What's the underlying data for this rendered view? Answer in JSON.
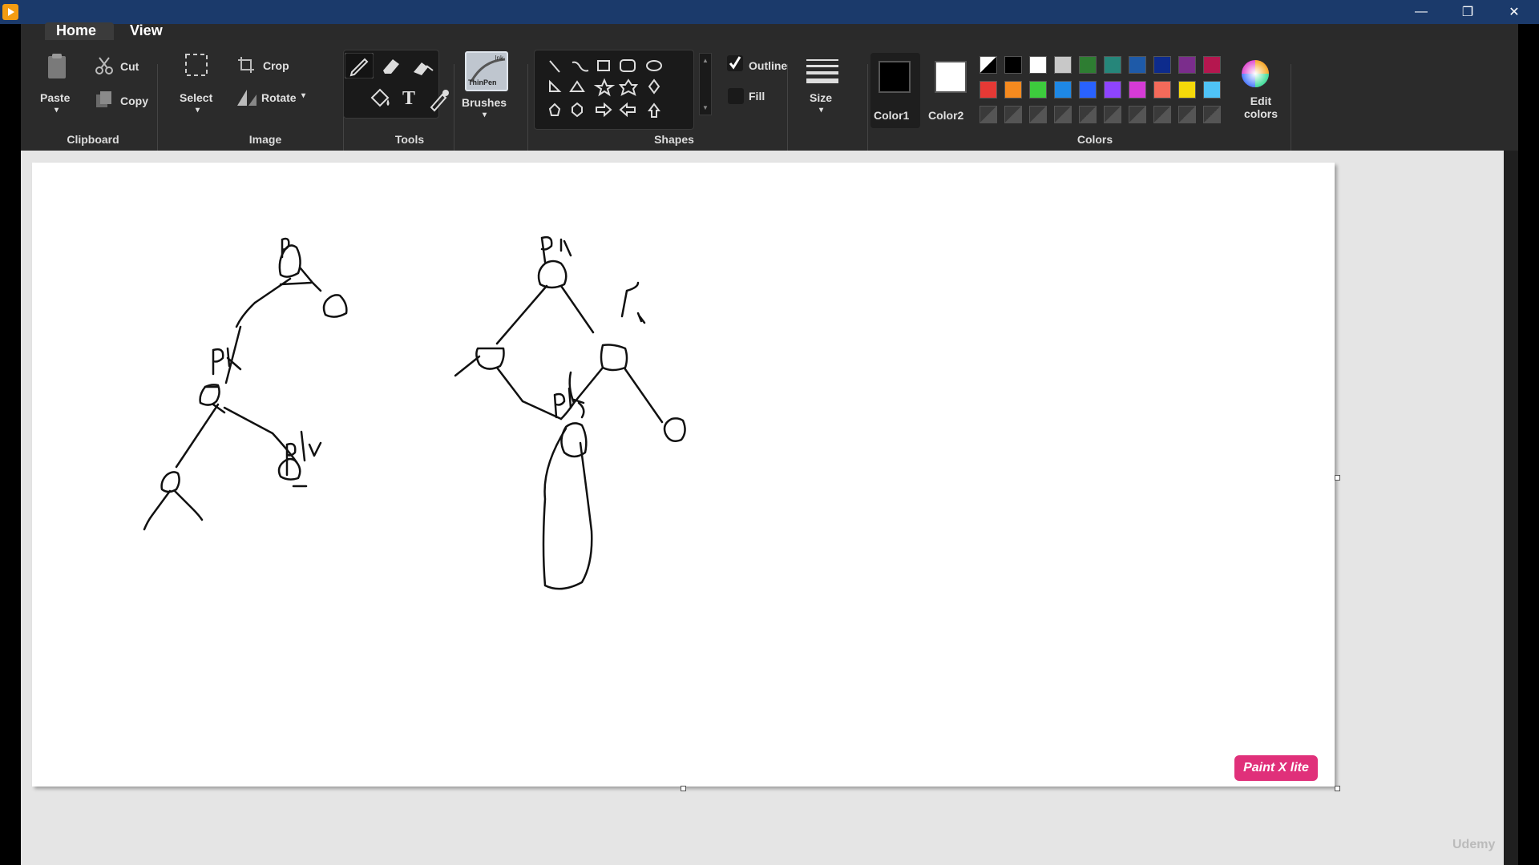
{
  "window": {
    "minimize": "—",
    "restore": "❐",
    "close": "✕"
  },
  "tabs": [
    {
      "label": "Home"
    },
    {
      "label": "View"
    }
  ],
  "clipboard": {
    "paste": "Paste",
    "cut": "Cut",
    "copy": "Copy",
    "group": "Clipboard"
  },
  "image": {
    "select": "Select",
    "crop": "Crop",
    "rotate": "Rotate",
    "group": "Image"
  },
  "tools": {
    "group": "Tools",
    "text_tool": "T"
  },
  "brushes": {
    "label": "Brushes",
    "preview_line1": "Ink",
    "preview_line2": "ThinPen"
  },
  "shapes": {
    "group": "Shapes",
    "outline": "Outline",
    "fill": "Fill",
    "outline_checked": true
  },
  "size": {
    "label": "Size"
  },
  "colors": {
    "group": "Colors",
    "color1_label": "Color1",
    "color2_label": "Color2",
    "color1": "#000000",
    "color2": "#ffffff",
    "edit_line1": "Edit",
    "edit_line2": "colors",
    "row1": [
      "diag",
      "#000000",
      "#ffffff",
      "#c8c8c8",
      "#2e7d32",
      "#26867a",
      "#1e5aa8",
      "#0d2b8c",
      "#7b2d8c",
      "#b5174f"
    ],
    "row2": [
      "#e53935",
      "#f58a1f",
      "#3dcb3d",
      "#1e88e5",
      "#2962ff",
      "#8e44ff",
      "#d63bd6",
      "#f46a5a",
      "#f5d90a",
      "#4fc3f7"
    ],
    "row3_count": 10
  },
  "canvas": {
    "labels": {
      "p_left": "p",
      "pl_left": "pl",
      "plr_left": "plr",
      "pl_mid": "Pl",
      "p_mid": "P",
      "plr_mid": "plr"
    },
    "badge": "Paint X lite"
  },
  "watermark": "Udemy"
}
